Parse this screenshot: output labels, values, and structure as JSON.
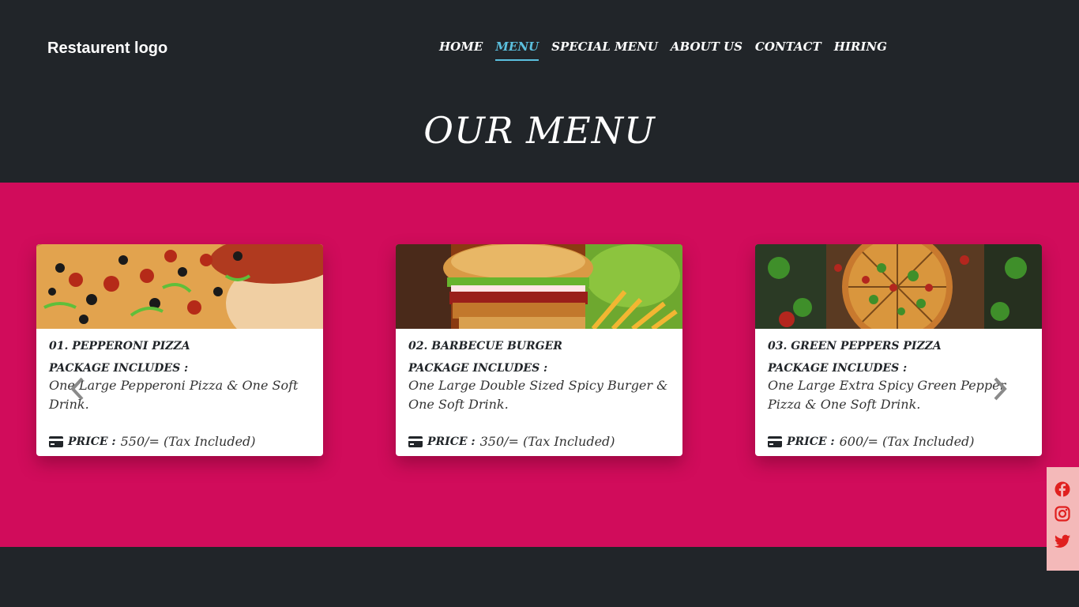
{
  "header": {
    "logo_text": "Restaurent logo",
    "nav": [
      {
        "label": "HOME",
        "active": false
      },
      {
        "label": "MENU",
        "active": true
      },
      {
        "label": "SPECIAL MENU",
        "active": false
      },
      {
        "label": "ABOUT US",
        "active": false
      },
      {
        "label": "CONTACT",
        "active": false
      },
      {
        "label": "HIRING",
        "active": false
      }
    ],
    "accent_color": "#5bc0de"
  },
  "page_title": "OUR MENU",
  "menu_band_color": "#d10c5b",
  "cards": [
    {
      "title": "01. PEPPERONI PIZZA",
      "package_label": "PACKAGE INCLUDES :",
      "package_text": "One Large Pepperoni Pizza & One Soft Drink.",
      "price_label": "PRICE :",
      "price_value": "550/= (Tax Included)",
      "image": "pepperoni-pizza-photo"
    },
    {
      "title": "02. BARBECUE BURGER",
      "package_label": "PACKAGE INCLUDES :",
      "package_text": "One Large Double Sized Spicy Burger & One Soft Drink.",
      "price_label": "PRICE :",
      "price_value": "350/= (Tax Included)",
      "image": "barbecue-burger-photo"
    },
    {
      "title": "03. GREEN PEPPERS PIZZA",
      "package_label": "PACKAGE INCLUDES :",
      "package_text": "One Large Extra Spicy Green Pepper Pizza & One Soft Drink.",
      "price_label": "PRICE :",
      "price_value": "600/= (Tax Included)",
      "image": "green-peppers-pizza-photo"
    }
  ],
  "carousel": {
    "prev_icon": "chevron-left-icon",
    "next_icon": "chevron-right-icon"
  },
  "social": [
    {
      "name": "facebook-icon",
      "color": "#e0201f"
    },
    {
      "name": "instagram-icon",
      "color": "#e0201f"
    },
    {
      "name": "twitter-icon",
      "color": "#e0201f"
    }
  ]
}
